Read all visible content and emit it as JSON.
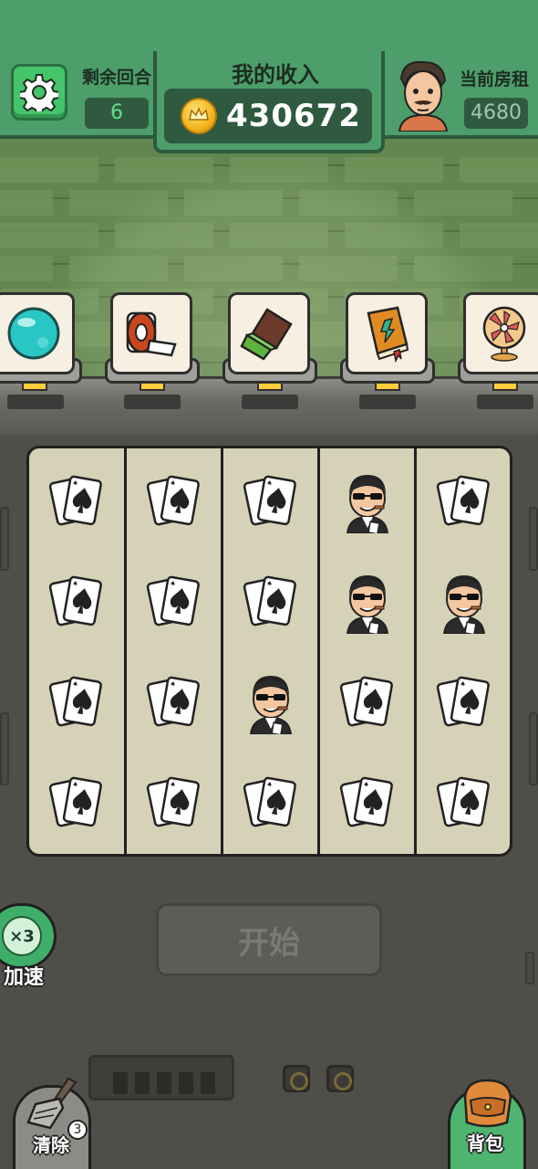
{
  "header": {
    "rounds_label": "剩余回合",
    "rounds_value": "6",
    "income_label": "我的收入",
    "income_value": "430672",
    "rent_label": "当前房租",
    "rent_value": "4680"
  },
  "items": [
    {
      "name": "orb",
      "icon": "teal-orb-icon"
    },
    {
      "name": "tissue",
      "icon": "tissue-roll-icon"
    },
    {
      "name": "chocolate",
      "icon": "chocolate-bar-icon"
    },
    {
      "name": "book",
      "icon": "spell-book-icon"
    },
    {
      "name": "fan",
      "icon": "electric-fan-icon"
    }
  ],
  "grid": [
    [
      "cards",
      "cards",
      "cards",
      "gangster",
      "cards"
    ],
    [
      "cards",
      "cards",
      "cards",
      "gangster",
      "gangster"
    ],
    [
      "cards",
      "cards",
      "gangster",
      "cards",
      "cards"
    ],
    [
      "cards",
      "cards",
      "cards",
      "cards",
      "cards"
    ]
  ],
  "controls": {
    "start_label": "开始",
    "speed_value": "×3",
    "speed_label": "加速",
    "clear_label": "清除",
    "clear_count": "3",
    "bag_label": "背包"
  },
  "colors": {
    "header_green": "#4d9e6b",
    "value_box": "#2f5a40",
    "value_text": "#62e08a",
    "board": "#d6d2b8",
    "settings_green": "#45c46c"
  }
}
